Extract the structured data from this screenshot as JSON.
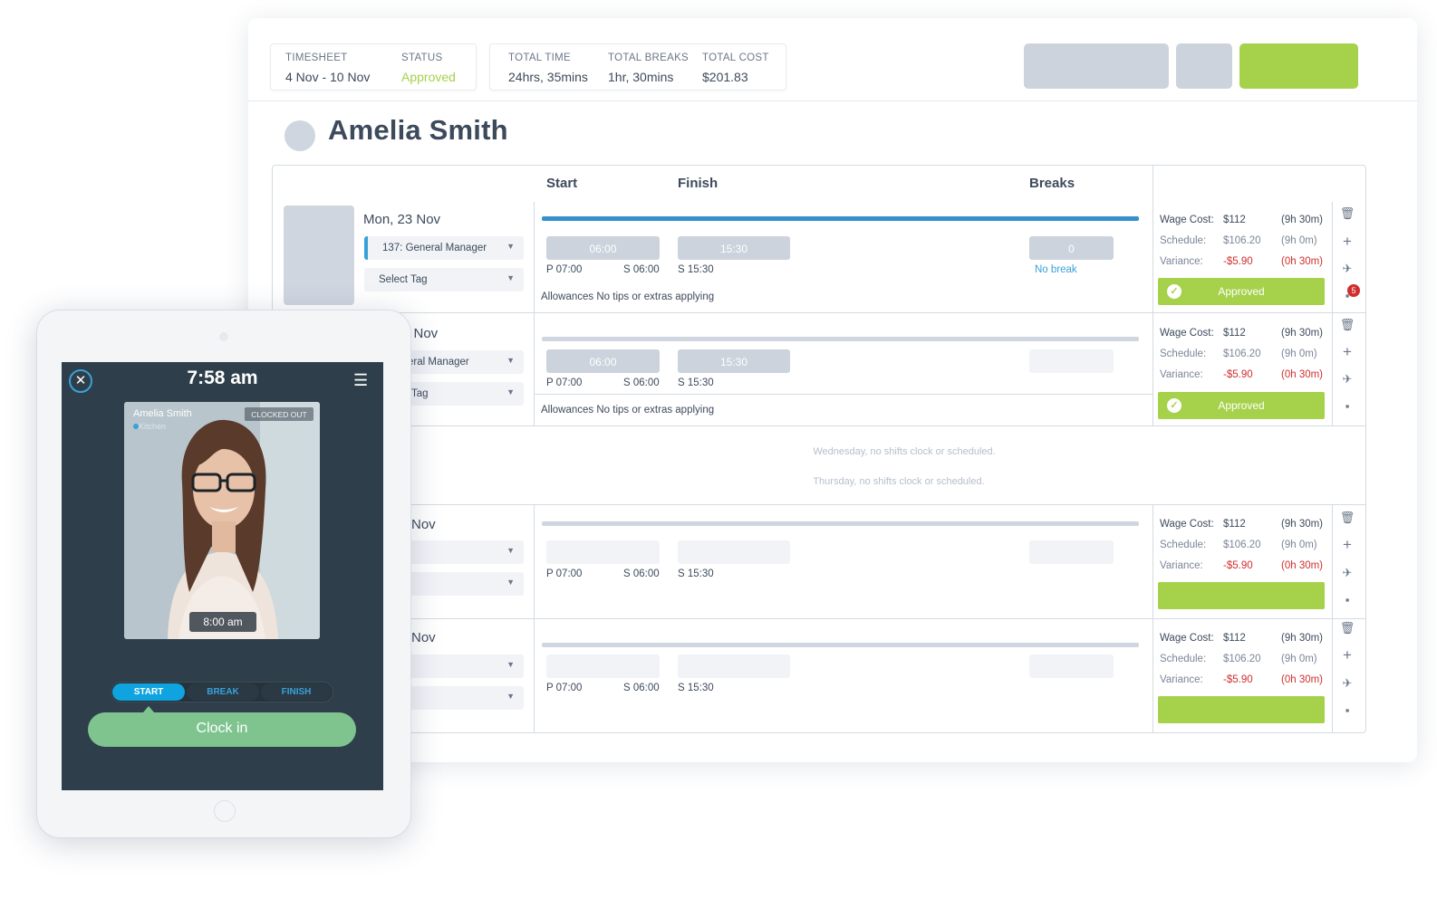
{
  "header": {
    "timesheet_label": "TIMESHEET",
    "timesheet_value": "4 Nov - 10 Nov",
    "status_label": "STATUS",
    "status_value": "Approved",
    "total_time_label": "TOTAL TIME",
    "total_time_value": "24hrs, 35mins",
    "total_breaks_label": "TOTAL BREAKS",
    "total_breaks_value": "1hr, 30mins",
    "total_cost_label": "TOTAL COST",
    "total_cost_value": "$201.83"
  },
  "employee": {
    "name": "Amelia Smith"
  },
  "columns": {
    "start": "Start",
    "finish": "Finish",
    "breaks": "Breaks"
  },
  "rows": [
    {
      "day": "Mon, 23 Nov",
      "role": "137: General Manager",
      "tag": "Select Tag",
      "start": "06:00",
      "finish": "15:30",
      "break_value": "0",
      "break_note": "No break",
      "p": "P 07:00",
      "s_start": "S 06:00",
      "s_finish": "S 15:30",
      "allowances": "Allowances  No tips or extras applying",
      "wage_label": "Wage Cost:",
      "wage_value": "$112",
      "wage_hours": "(9h 30m)",
      "schedule_label": "Schedule:",
      "schedule_value": "$106.20",
      "schedule_hours": "(9h 0m)",
      "variance_label": "Variance:",
      "variance_value": "-$5.90",
      "variance_hours": "(0h 30m)",
      "approved": "Approved",
      "comment_count": "5"
    },
    {
      "day": "4 Nov",
      "role": "eral Manager",
      "tag": "Tag",
      "start": "06:00",
      "finish": "15:30",
      "p": "P 07:00",
      "s_start": "S 06:00",
      "s_finish": "S 15:30",
      "allowances": "Allowances  No tips or extras applying",
      "wage_label": "Wage Cost:",
      "wage_value": "$112",
      "wage_hours": "(9h 30m)",
      "schedule_label": "Schedule:",
      "schedule_value": "$106.20",
      "schedule_hours": "(9h 0m)",
      "variance_label": "Variance:",
      "variance_value": "-$5.90",
      "variance_hours": "(0h 30m)",
      "approved": "Approved"
    },
    {
      "day": "Nov",
      "p": "P 07:00",
      "s_start": "S 06:00",
      "s_finish": "S 15:30",
      "wage_label": "Wage Cost:",
      "wage_value": "$112",
      "wage_hours": "(9h 30m)",
      "schedule_label": "Schedule:",
      "schedule_value": "$106.20",
      "schedule_hours": "(9h 0m)",
      "variance_label": "Variance:",
      "variance_value": "-$5.90",
      "variance_hours": "(0h 30m)"
    },
    {
      "day": "Nov",
      "p": "P 07:00",
      "s_start": "S 06:00",
      "s_finish": "S 15:30",
      "wage_label": "Wage Cost:",
      "wage_value": "$112",
      "wage_hours": "(9h 30m)",
      "schedule_label": "Schedule:",
      "schedule_value": "$106.20",
      "schedule_hours": "(9h 0m)",
      "variance_label": "Variance:",
      "variance_value": "-$5.90",
      "variance_hours": "(0h 30m)"
    }
  ],
  "no_shift": {
    "wednesday": "Wednesday, no shifts clock or scheduled.",
    "thursday": "Thursday, no shifts clock or scheduled."
  },
  "kiosk": {
    "time": "7:58 am",
    "person_name": "Amelia Smith",
    "department": "Kitchen",
    "status": "CLOCKED OUT",
    "photo_time": "8:00 am",
    "tabs": [
      "START",
      "BREAK",
      "FINISH"
    ],
    "active_tab": "START",
    "clock_in_label": "Clock in"
  },
  "colors": {
    "accent_blue": "#3aa1d8",
    "approved_green": "#a6d14b",
    "clock_in_green": "#7fc48f",
    "variance_red": "#d12e2e",
    "kiosk_bg": "#2e3f4b"
  },
  "icons": [
    "trash-icon",
    "plus-icon",
    "plane-icon",
    "comment-icon",
    "close-icon",
    "menu-icon",
    "check-icon",
    "chevron-down-icon"
  ]
}
